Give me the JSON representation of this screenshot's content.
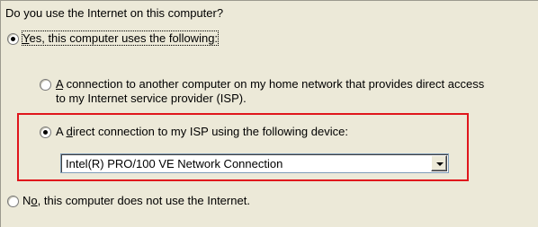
{
  "question": "Do you use the Internet on this computer?",
  "options": {
    "yes": {
      "key": "Y",
      "rest": "es, this computer uses the following:",
      "selected": true
    },
    "another_computer": {
      "key": "A",
      "rest": " connection to another computer on my home network that provides direct access",
      "line2": "to my Internet service provider (ISP).",
      "selected": false
    },
    "direct": {
      "pre": "A ",
      "key": "d",
      "rest": "irect connection to my ISP using the following device:",
      "selected": true
    },
    "no": {
      "pre": "N",
      "key": "o",
      "rest": ", this computer does not use the Internet.",
      "selected": false
    }
  },
  "device_select": {
    "value": "Intel(R) PRO/100 VE Network Connection"
  },
  "colors": {
    "background": "#ece9d8",
    "highlight_box": "#e0161c"
  }
}
